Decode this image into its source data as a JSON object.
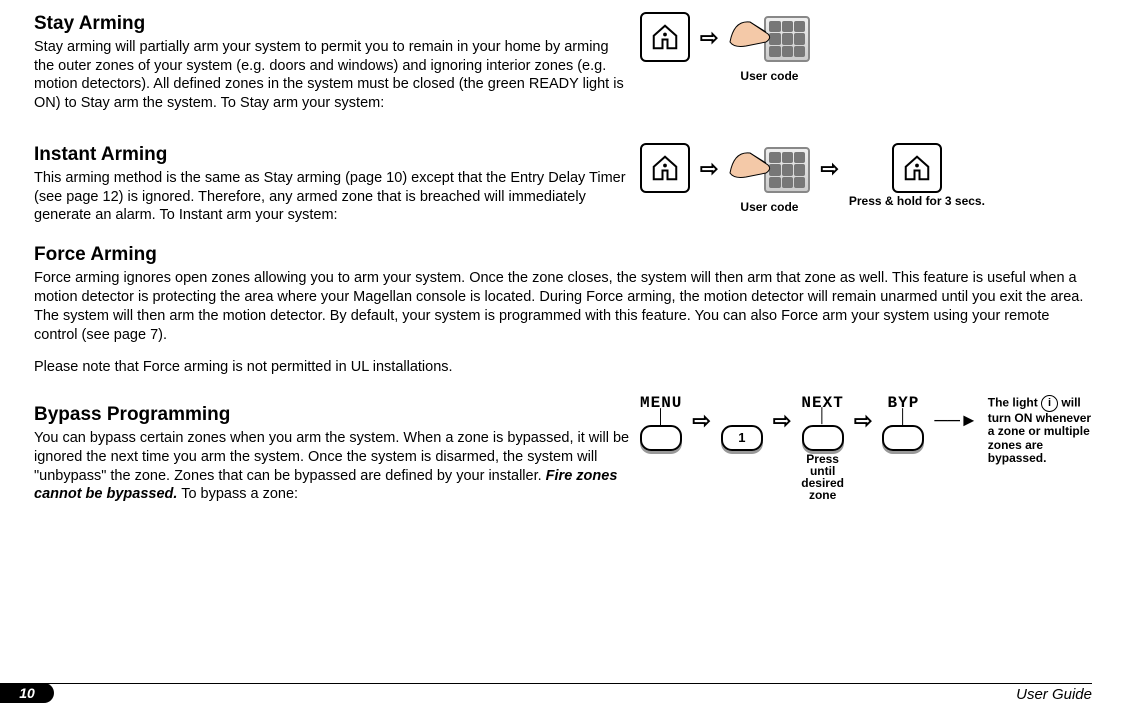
{
  "sections": {
    "stay": {
      "title": "Stay Arming",
      "body": "Stay arming will partially arm your system to permit you to remain in your home by arming the outer zones of your system (e.g. doors and windows) and ignoring interior zones (e.g. motion detectors). All defined zones in the system must be closed (the green READY light is ON) to Stay arm the system. To Stay arm your system:"
    },
    "instant": {
      "title": "Instant Arming",
      "body": "This arming method is the same as Stay arming (page 10) except that the Entry Delay Timer (see page 12) is ignored. Therefore, any armed zone that is breached will immediately generate an alarm. To Instant arm your system:"
    },
    "force": {
      "title": "Force Arming",
      "body": "Force arming ignores open zones allowing you to arm your system. Once the zone closes, the system will then arm that zone as well. This feature is useful when a motion detector is protecting the area where your Magellan console is located. During Force arming, the motion detector will remain unarmed until you exit the area. The system will then arm the motion detector. By default, your system is programmed with this feature. You can also Force arm your system using your remote control (see page 7).",
      "note": "Please note that Force arming is not permitted in UL installations."
    },
    "bypass": {
      "title": "Bypass Programming",
      "body_a": "You can bypass certain zones when you arm the system. When a zone is bypassed, it will be ignored the next time you arm the system. Once the system is disarmed, the system will \"unbypass\" the zone. Zones that can be bypassed are defined by your installer. ",
      "body_b": "Fire zones cannot be bypassed.",
      "body_c": " To bypass a zone:"
    }
  },
  "diagram": {
    "user_code": "User code",
    "press_hold": "Press & hold for 3 secs.",
    "menu": "MENU",
    "next": "NEXT",
    "byp": "BYP",
    "one": "1",
    "press_until": "Press until desired zone",
    "tip_a": "The light ",
    "tip_b": " will turn ON whenever a zone or multiple zones are bypassed.",
    "info_i": "i"
  },
  "footer": {
    "page": "10",
    "label": "User Guide"
  }
}
